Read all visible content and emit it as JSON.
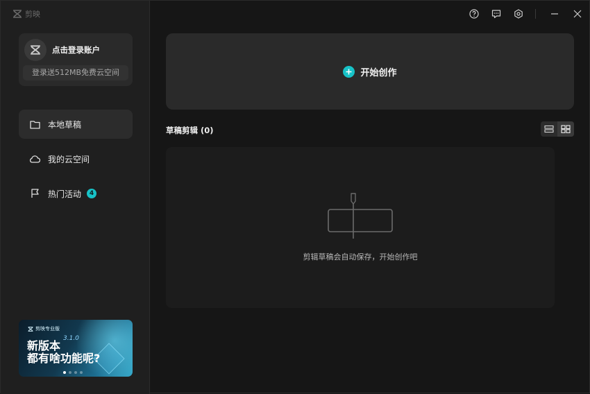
{
  "app": {
    "name": "剪映"
  },
  "sidebar": {
    "login": {
      "label": "点击登录账户",
      "promo": "登录送512MB免费云空间"
    },
    "items": [
      {
        "label": "本地草稿",
        "icon": "folder-icon"
      },
      {
        "label": "我的云空间",
        "icon": "cloud-icon"
      },
      {
        "label": "热门活动",
        "icon": "flag-icon",
        "badge": "4"
      }
    ],
    "banner": {
      "logo_text": "剪映专业版",
      "version": "3.1.0",
      "line1": "新版本",
      "line2": "都有啥功能呢?"
    }
  },
  "topbar": {
    "icons": [
      "help-icon",
      "feedback-icon",
      "settings-icon",
      "minimize-icon",
      "close-icon"
    ]
  },
  "main": {
    "create_label": "开始创作",
    "drafts_title": "草稿剪辑  (0)",
    "empty_text": "剪辑草稿会自动保存，开始创作吧"
  },
  "colors": {
    "accent": "#17c2c7",
    "background": "#161616",
    "sidebar": "#1f1f1f",
    "card": "#2a2a2a"
  }
}
